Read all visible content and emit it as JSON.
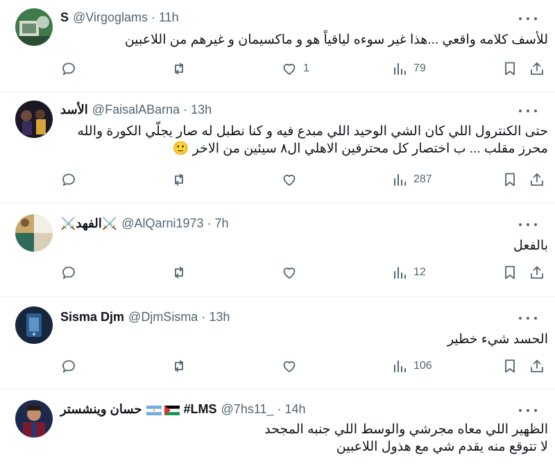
{
  "tweets": [
    {
      "name": "S",
      "handle": "@Virgoglams",
      "time": "11h",
      "lines": [
        "للأسف كلامه واقعي ...هذا غير سوءه لياقياً هو و ماكسيمان و غيرهم من اللاعبين"
      ],
      "reply_count": "",
      "retweet_count": "",
      "like_count": "1",
      "view_count": "79"
    },
    {
      "name": "الأسد",
      "handle": "@FaisalABarna",
      "time": "13h",
      "lines": [
        "حتى الكنترول اللي كان الشي الوحيد اللي مبدع فيه و كنا نطبل له صار يجلّي الكورة والله",
        "محرز مقلب ... ب اختصار كل محترفين الاهلي ال٨ سيئين من الاخر 🙂"
      ],
      "reply_count": "",
      "retweet_count": "",
      "like_count": "",
      "view_count": "287"
    },
    {
      "name": "⚔️الفهد⚔️",
      "handle": "@AlQarni1973",
      "time": "7h",
      "lines": [
        "بالفعل"
      ],
      "reply_count": "",
      "retweet_count": "",
      "like_count": "",
      "view_count": "12"
    },
    {
      "name": "Sisma Djm",
      "handle": "@DjmSisma",
      "time": "13h",
      "lines": [
        "الحسد شيء خطير"
      ],
      "reply_count": "",
      "retweet_count": "",
      "like_count": "",
      "view_count": "106"
    },
    {
      "name": "حسان وينشستر",
      "name_suffix": "#LMS",
      "handle": "@7hs11_",
      "time": "14h",
      "lines": [
        "الظهير اللي معاه مجرشي والوسط اللي جنبه المجحد",
        "لا تتوقع منه يقدم شي مع هذول اللاعبين"
      ]
    }
  ],
  "separator": "·",
  "colors": {
    "text": "#0f1419",
    "muted": "#536471",
    "border": "#eff3f4"
  },
  "icons": [
    "reply-icon",
    "retweet-icon",
    "like-icon",
    "views-icon",
    "bookmark-icon",
    "share-icon",
    "more-icon"
  ]
}
